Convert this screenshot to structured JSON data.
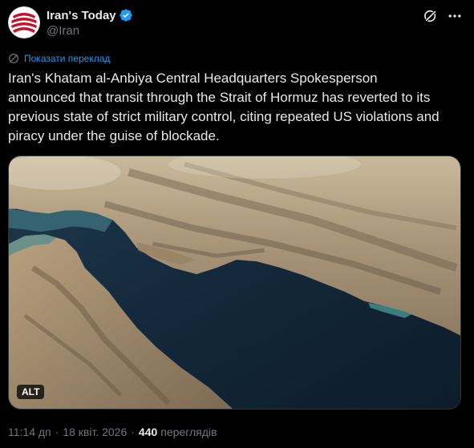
{
  "author": {
    "display_name": "Iran's Today",
    "handle": "@Iran",
    "verified": true
  },
  "translate": {
    "label": "Показати переклад",
    "icon": "translate-icon"
  },
  "tweet": {
    "text": "Iran's Khatam al-Anbiya Central Headquarters Spokesperson\nannounced that transit through the Strait of Hormuz has reverted to its\nprevious state of strict military control, citing repeated US violations and\npiracy under the guise of blockade."
  },
  "media": {
    "alt_label": "ALT"
  },
  "meta": {
    "time": "11:14 дп",
    "separator": "·",
    "date": "18 квіт. 2026",
    "views_count": "440",
    "views_label": "переглядів"
  },
  "colors": {
    "accent": "#1d9bf0",
    "background": "#000000",
    "text": "#e7e9ea",
    "muted": "#71767b"
  },
  "icons": {
    "verified": "verified-badge-icon",
    "grok": "grok-icon",
    "more": "more-options-icon"
  }
}
